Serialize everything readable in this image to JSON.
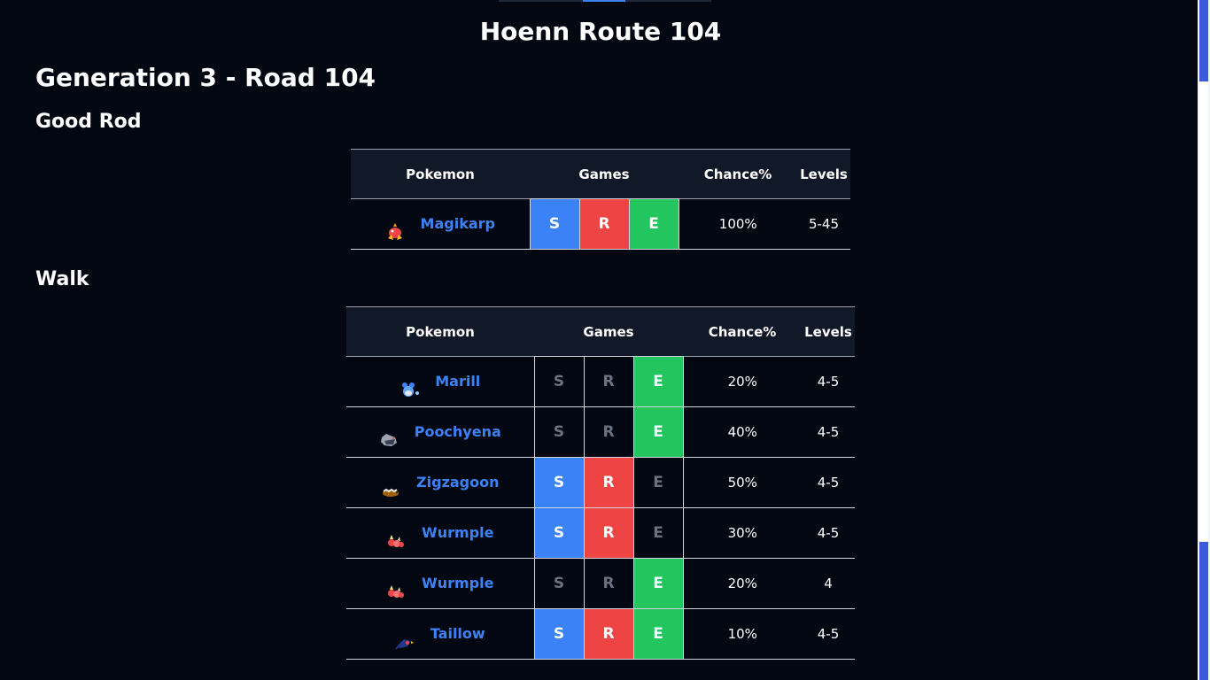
{
  "header": {
    "title": "Hoenn Route 104"
  },
  "generation_heading": "Generation 3 - Road 104",
  "columns": {
    "pokemon": "Pokemon",
    "games": "Games",
    "chance": "Chance%",
    "levels": "Levels"
  },
  "colors": {
    "sapphire": "#3b82f6",
    "ruby": "#ef4444",
    "emerald": "#22c55e",
    "background": "#030712",
    "link": "#3b82f6"
  },
  "sections": [
    {
      "title": "Good Rod",
      "rows": [
        {
          "name": "Magikarp",
          "sprite": "magikarp-sprite-icon",
          "s": true,
          "r": true,
          "e": true,
          "chance": "100%",
          "levels": "5-45"
        }
      ]
    },
    {
      "title": "Walk",
      "rows": [
        {
          "name": "Marill",
          "sprite": "marill-sprite-icon",
          "s": false,
          "r": false,
          "e": true,
          "chance": "20%",
          "levels": "4-5"
        },
        {
          "name": "Poochyena",
          "sprite": "poochyena-sprite-icon",
          "s": false,
          "r": false,
          "e": true,
          "chance": "40%",
          "levels": "4-5"
        },
        {
          "name": "Zigzagoon",
          "sprite": "zigzagoon-sprite-icon",
          "s": true,
          "r": true,
          "e": false,
          "chance": "50%",
          "levels": "4-5"
        },
        {
          "name": "Wurmple",
          "sprite": "wurmple-sprite-icon",
          "s": true,
          "r": true,
          "e": false,
          "chance": "30%",
          "levels": "4-5"
        },
        {
          "name": "Wurmple",
          "sprite": "wurmple-sprite-icon",
          "s": false,
          "r": false,
          "e": true,
          "chance": "20%",
          "levels": "4"
        },
        {
          "name": "Taillow",
          "sprite": "taillow-sprite-icon",
          "s": true,
          "r": true,
          "e": true,
          "chance": "10%",
          "levels": "4-5"
        }
      ]
    }
  ],
  "game_letters": {
    "s": "S",
    "r": "R",
    "e": "E"
  }
}
